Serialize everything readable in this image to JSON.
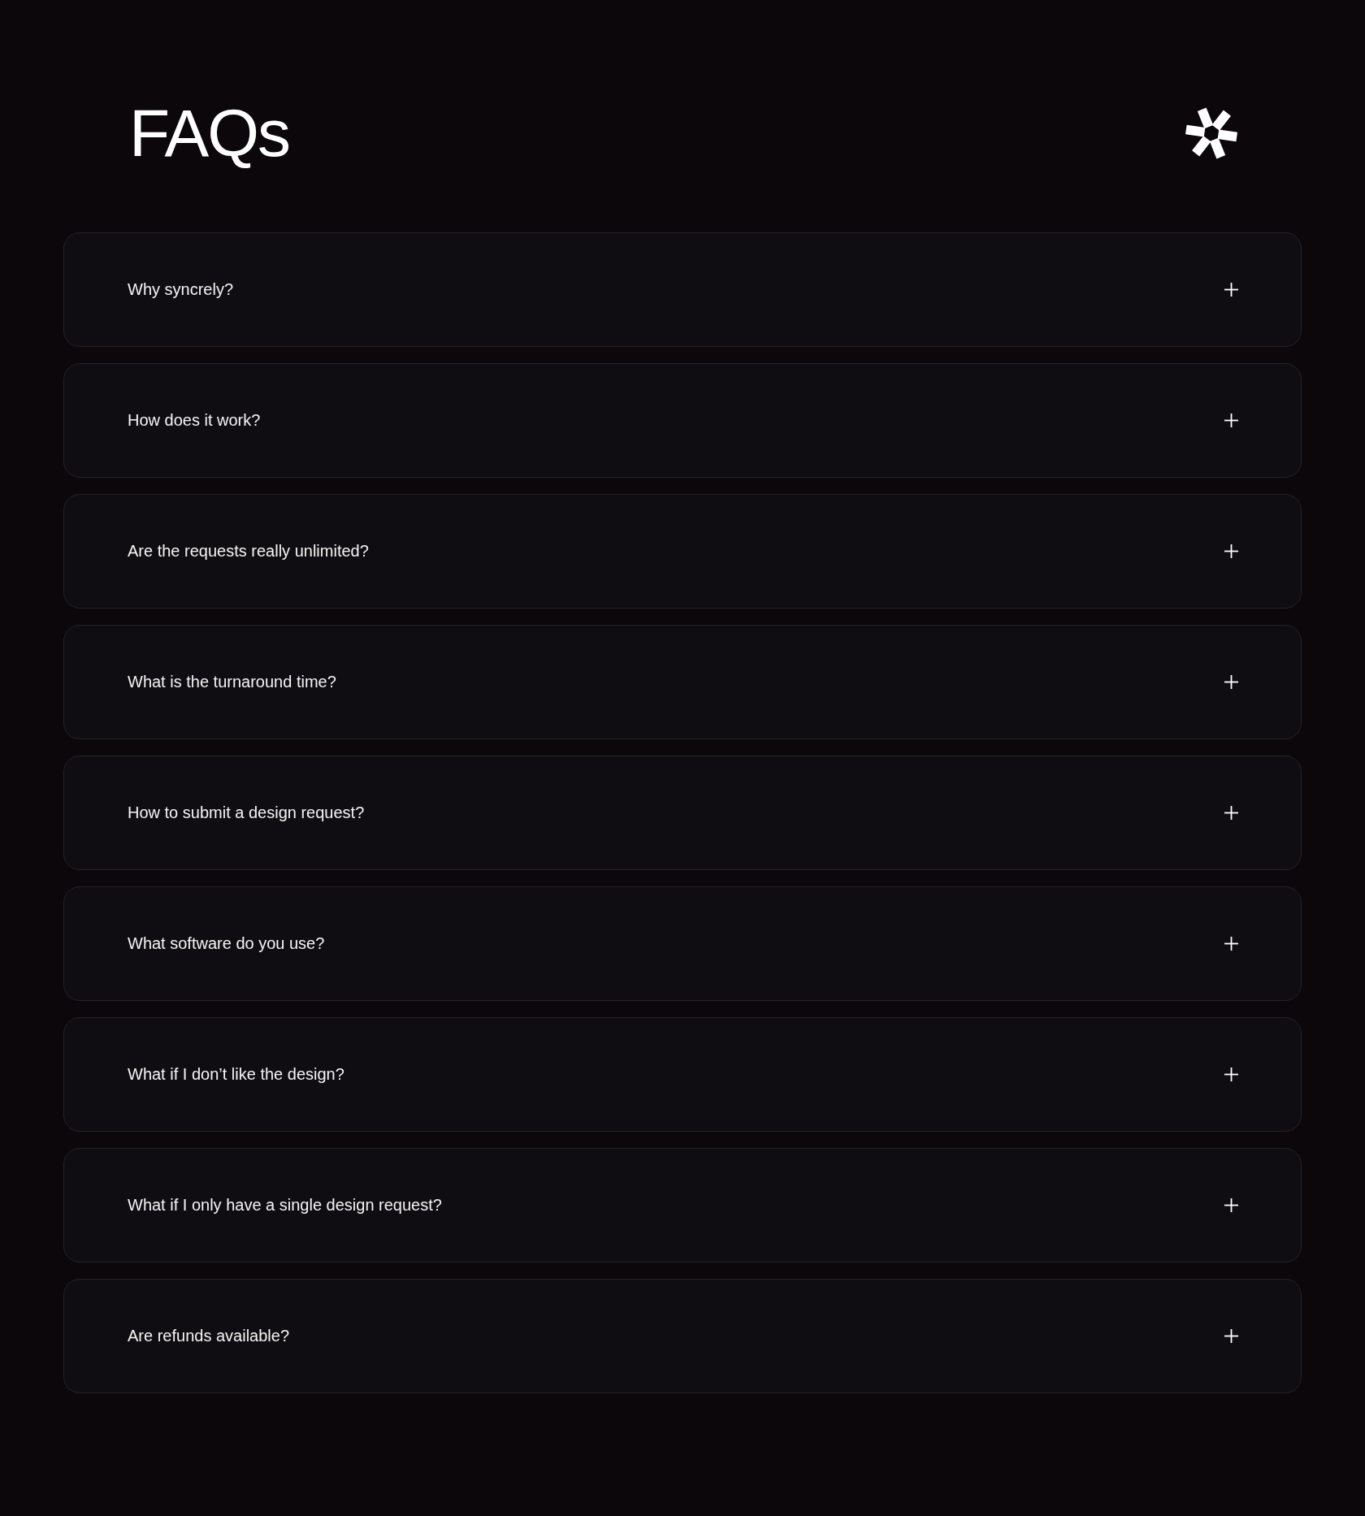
{
  "header": {
    "title": "FAQs"
  },
  "faqs": [
    {
      "question": "Why syncrely?",
      "expanded": false
    },
    {
      "question": "How does it work?",
      "expanded": false
    },
    {
      "question": "Are the requests really unlimited?",
      "expanded": false
    },
    {
      "question": "What is the turnaround time?",
      "expanded": false
    },
    {
      "question": "How to submit a design request?",
      "expanded": false
    },
    {
      "question": "What software do you use?",
      "expanded": false
    },
    {
      "question": "What if I don’t like the design?",
      "expanded": false
    },
    {
      "question": "What if I only have a single design request?",
      "expanded": false
    },
    {
      "question": "Are refunds available?",
      "expanded": false
    }
  ]
}
